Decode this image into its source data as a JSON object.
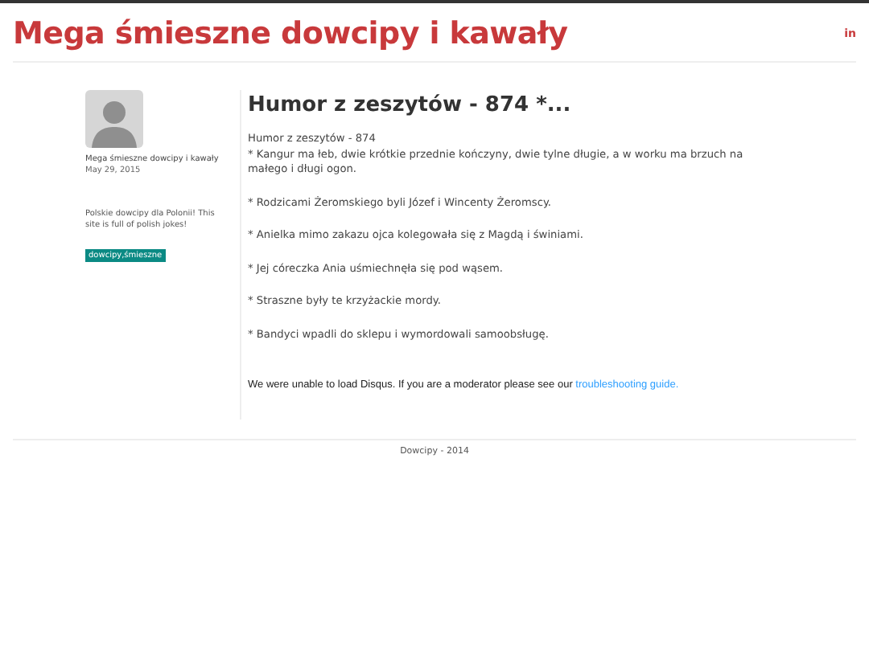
{
  "header": {
    "title": "Mega śmieszne dowcipy i kawały",
    "social": "in"
  },
  "sidebar": {
    "author": "Mega śmieszne dowcipy i kawały",
    "date": "May 29, 2015",
    "description": "Polskie dowcipy dla Polonii! This site is full of polish jokes!",
    "tag": "dowcipy,śmieszne"
  },
  "post": {
    "title": "Humor z zeszytów - 874 *...",
    "paragraphs": [
      "Humor z zeszytów - 874\n* Kangur ma łeb, dwie krótkie przednie kończyny, dwie tylne długie, a w worku ma brzuch na małego i długi ogon.",
      "* Rodzicami Żeromskiego byli Józef i Wincenty Żeromscy.",
      "* Anielka mimo zakazu ojca kolegowała się z Magdą i świniami.",
      "* Jej córeczka Ania uśmiechnęła się pod wąsem.",
      "* Straszne były te krzyżackie mordy.",
      "* Bandyci wpadli do sklepu i wymordowali samoobsługę."
    ],
    "comments": {
      "message": "We were unable to load Disqus. If you are a moderator please see our",
      "link": "troubleshooting guide."
    }
  },
  "footer": "Dowcipy - 2014"
}
